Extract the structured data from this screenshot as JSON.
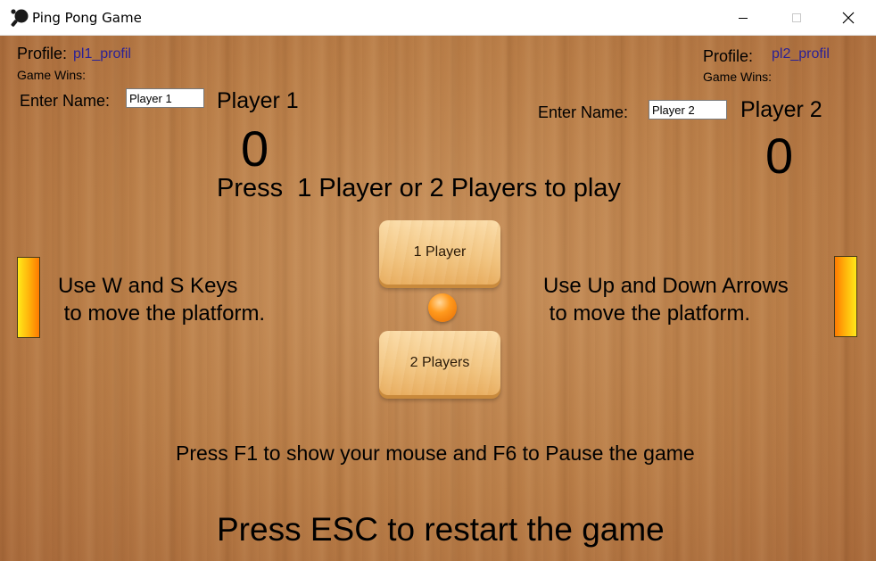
{
  "window": {
    "title": "Ping Pong Game",
    "app_icon": "ping-pong-paddle-icon",
    "controls": [
      "minimize-icon",
      "maximize-icon",
      "close-icon"
    ]
  },
  "player1": {
    "profile_label": "Profile:",
    "profile_value": "pl1_profil",
    "game_wins_label": "Game Wins:",
    "enter_name_label": "Enter Name:",
    "name_value": "Player 1",
    "player_label": "Player 1",
    "score": "0",
    "instructions": "Use W and S Keys\n to move the platform."
  },
  "player2": {
    "profile_label": "Profile:",
    "profile_value": "pl2_profil",
    "game_wins_label": "Game Wins:",
    "enter_name_label": "Enter Name:",
    "name_value": "Player 2",
    "player_label": "Player 2",
    "score": "0",
    "instructions": "Use Up and Down Arrows\n to move the platform."
  },
  "center": {
    "prompt": "Press  1 Player or 2 Players to play",
    "one_player_button": "1 Player",
    "two_players_button": "2 Players"
  },
  "footer": {
    "hint": "Press F1 to show your mouse and F6 to Pause the game",
    "esc_message": "Press ESC to restart the game"
  },
  "colors": {
    "profile_value": "#2a2196",
    "paddle_yellow": "#ffe81a",
    "paddle_orange": "#ff7a00",
    "ball": "#ff9a1e",
    "table_wood": "#b97d47"
  }
}
